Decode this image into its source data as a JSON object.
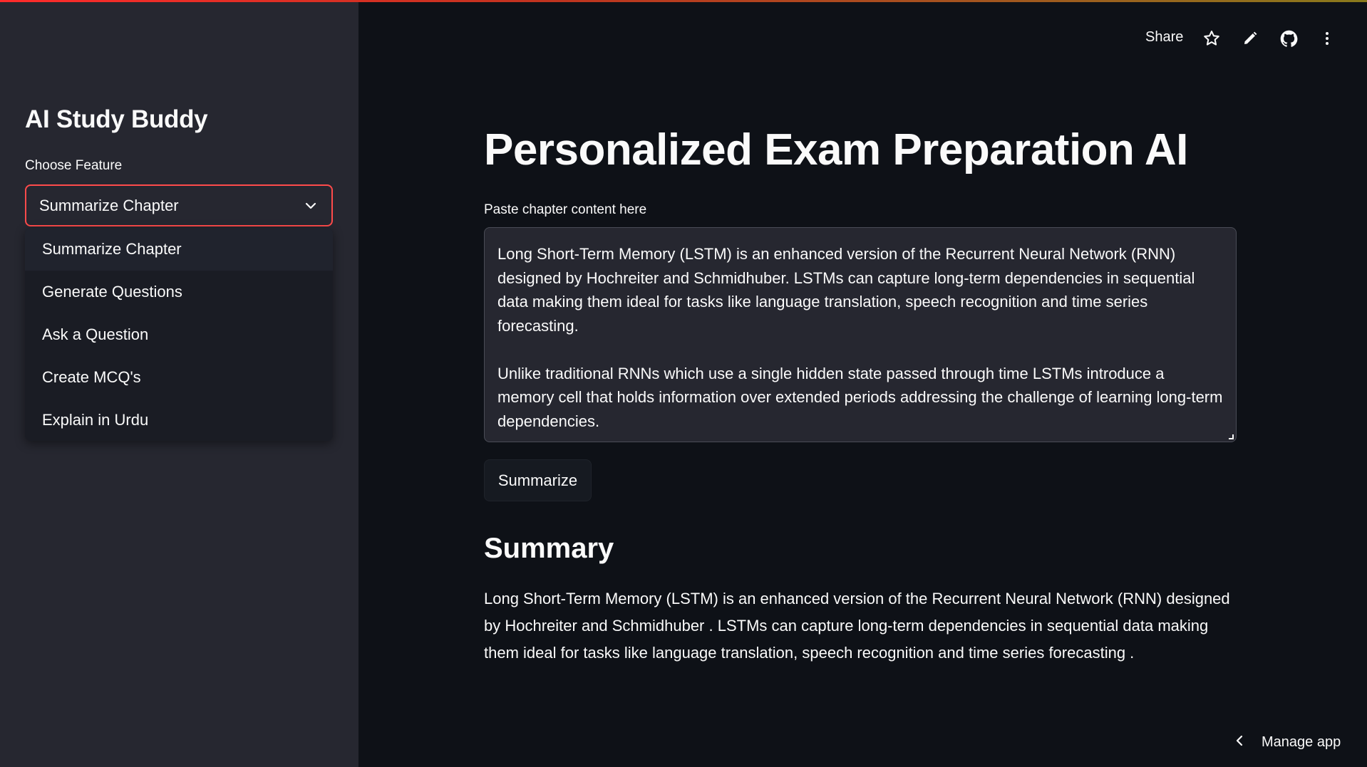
{
  "sidebar": {
    "title": "AI Study Buddy",
    "select_label": "Choose Feature",
    "selected_value": "Summarize Chapter",
    "options": [
      "Summarize Chapter",
      "Generate Questions",
      "Ask a Question",
      "Create MCQ's",
      "Explain in Urdu"
    ]
  },
  "header": {
    "share_label": "Share",
    "icons": [
      "star-icon",
      "pencil-icon",
      "github-icon",
      "more-vertical-icon"
    ]
  },
  "main": {
    "title": "Personalized Exam Preparation AI",
    "textarea_label": "Paste chapter content here",
    "textarea_paragraphs": [
      "Long Short-Term Memory (LSTM) is an enhanced version of the Recurrent Neural Network (RNN) designed by Hochreiter and Schmidhuber. LSTMs can capture long-term dependencies in sequential data making them ideal for tasks like language translation, speech recognition and time series forecasting.",
      "Unlike traditional RNNs which use a single hidden state passed through time LSTMs introduce a memory cell that holds information over extended periods addressing the challenge of learning long-term dependencies."
    ],
    "summarize_button": "Summarize",
    "summary_heading": "Summary",
    "summary_text": "Long Short-Term Memory (LSTM) is an enhanced version of the Recurrent Neural Network (RNN) designed by Hochreiter and Schmidhuber . LSTMs can capture long-term dependencies in sequential data making them ideal for tasks like language translation, speech recognition and time series forecasting ."
  },
  "footer": {
    "manage_app_label": "Manage app"
  },
  "colors": {
    "background": "#0e1117",
    "sidebar": "#262730",
    "accent": "#ff4b4b",
    "text": "#fafafa"
  }
}
